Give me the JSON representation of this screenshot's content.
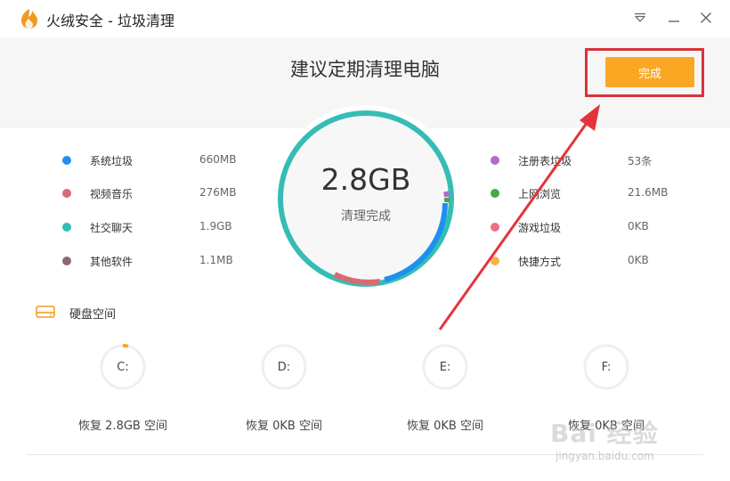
{
  "window": {
    "title": "火绒安全 - 垃圾清理"
  },
  "header": {
    "title": "建议定期清理电脑",
    "done_label": "完成"
  },
  "summary": {
    "value": "2.8GB",
    "label": "清理完成"
  },
  "categories_left": [
    {
      "name": "系统垃圾",
      "value": "660MB",
      "color": "#1e90f0"
    },
    {
      "name": "视频音乐",
      "value": "276MB",
      "color": "#d96a72"
    },
    {
      "name": "社交聊天",
      "value": "1.9GB",
      "color": "#35bdb5"
    },
    {
      "name": "其他软件",
      "value": "1.1MB",
      "color": "#8a6a6e"
    }
  ],
  "categories_right": [
    {
      "name": "注册表垃圾",
      "value": "53条",
      "color": "#b36cc8"
    },
    {
      "name": "上网浏览",
      "value": "21.6MB",
      "color": "#45a84a"
    },
    {
      "name": "游戏垃圾",
      "value": "0KB",
      "color": "#ef6f86"
    },
    {
      "name": "快捷方式",
      "value": "0KB",
      "color": "#f7b24a"
    }
  ],
  "disk": {
    "section_title": "硬盘空间",
    "drives": [
      {
        "letter": "C:",
        "info": "恢复 2.8GB 空间",
        "used": 0.04
      },
      {
        "letter": "D:",
        "info": "恢复 0KB 空间",
        "used": 0
      },
      {
        "letter": "E:",
        "info": "恢复 0KB 空间",
        "used": 0
      },
      {
        "letter": "F:",
        "info": "恢复 0KB 空间",
        "used": 0
      }
    ]
  },
  "watermark": {
    "main": "Bai 经验",
    "sub": "jingyan.baidu.com"
  },
  "colors": {
    "accent": "#fba724",
    "annotation": "#d9333a",
    "ring_main": "#35bdb5"
  }
}
